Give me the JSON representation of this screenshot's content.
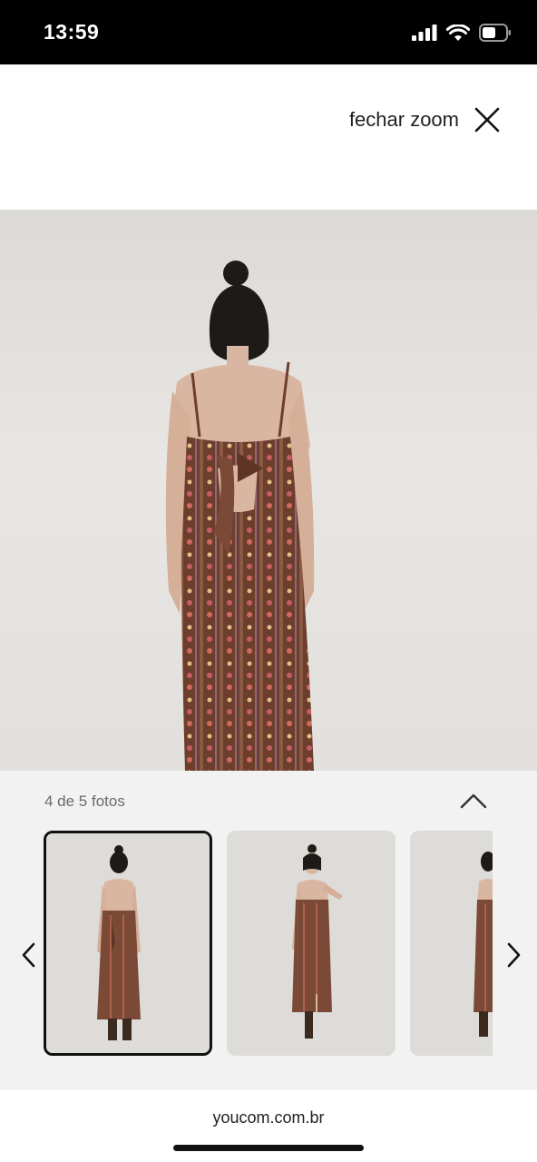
{
  "status_bar": {
    "time": "13:59",
    "icons": [
      "cellular-signal-icon",
      "wifi-icon",
      "battery-icon"
    ]
  },
  "zoom": {
    "close_label": "fechar zoom",
    "close_icon": "close-icon"
  },
  "gallery": {
    "counter": "4 de 5 fotos",
    "collapse_icon": "chevron-up-icon",
    "prev_icon": "chevron-left-icon",
    "next_icon": "chevron-right-icon",
    "thumbnails": [
      {
        "view": "back",
        "selected": true
      },
      {
        "view": "front",
        "selected": false
      },
      {
        "view": "side",
        "selected": false
      }
    ]
  },
  "browser": {
    "url": "youcom.com.br"
  },
  "colors": {
    "dress": "#7a4a36",
    "dress_pattern": "#c86a5a",
    "background": "#e6e4e1",
    "skin": "#d9b6a1",
    "hair": "#1e1a18"
  }
}
